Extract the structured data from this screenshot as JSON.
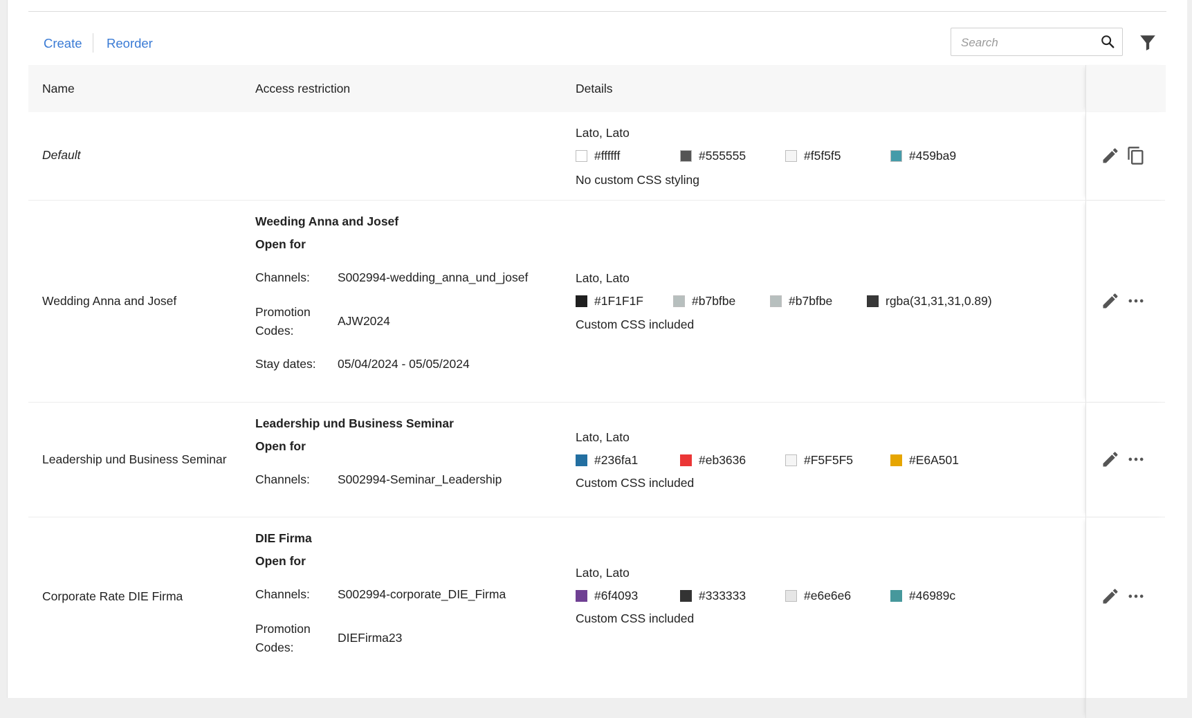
{
  "toolbar": {
    "create_label": "Create",
    "reorder_label": "Reorder",
    "search_placeholder": "Search",
    "search_value": ""
  },
  "columns": [
    "Name",
    "Access restriction",
    "Details"
  ],
  "rows": [
    {
      "name": "Default",
      "access": null,
      "details": {
        "font": "Lato, Lato",
        "colors": [
          "#ffffff",
          "#555555",
          "#f5f5f5",
          "#459ba9"
        ],
        "css": "No custom CSS styling"
      },
      "actions": [
        "edit-icon",
        "copy-icon"
      ]
    },
    {
      "name": "Wedding Anna and Josef",
      "access": {
        "title": "Weeding Anna and Josef",
        "open_for": "Open for",
        "fields": [
          {
            "label": "Channels:",
            "value": "S002994-wedding_anna_und_josef"
          },
          {
            "label": "Promotion Codes:",
            "value": "AJW2024"
          },
          {
            "label": "Stay dates:",
            "value": "05/04/2024 - 05/05/2024"
          }
        ]
      },
      "details": {
        "font": "Lato, Lato",
        "colors": [
          "#1F1F1F",
          "#b7bfbe",
          "#b7bfbe",
          "rgba(31,31,31,0.89)"
        ],
        "css": "Custom CSS included"
      },
      "actions": [
        "edit-icon",
        "more-icon"
      ]
    },
    {
      "name": "Leadership und Business Seminar",
      "access": {
        "title": "Leadership und Business Seminar",
        "open_for": "Open for",
        "fields": [
          {
            "label": "Channels:",
            "value": "S002994-Seminar_Leadership"
          }
        ]
      },
      "details": {
        "font": "Lato, Lato",
        "colors": [
          "#236fa1",
          "#eb3636",
          "#F5F5F5",
          "#E6A501"
        ],
        "css": "Custom CSS included"
      },
      "actions": [
        "edit-icon",
        "more-icon"
      ]
    },
    {
      "name": "Corporate Rate DIE Firma",
      "access": {
        "title": "DIE Firma",
        "open_for": "Open for",
        "fields": [
          {
            "label": "Channels:",
            "value": "S002994-corporate_DIE_Firma"
          },
          {
            "label": "Promotion Codes:",
            "value": "DIEFirma23"
          }
        ]
      },
      "details": {
        "font": "Lato, Lato",
        "colors": [
          "#6f4093",
          "#333333",
          "#e6e6e6",
          "#46989c"
        ],
        "css": "Custom CSS included"
      },
      "actions": [
        "edit-icon",
        "more-icon"
      ]
    }
  ]
}
